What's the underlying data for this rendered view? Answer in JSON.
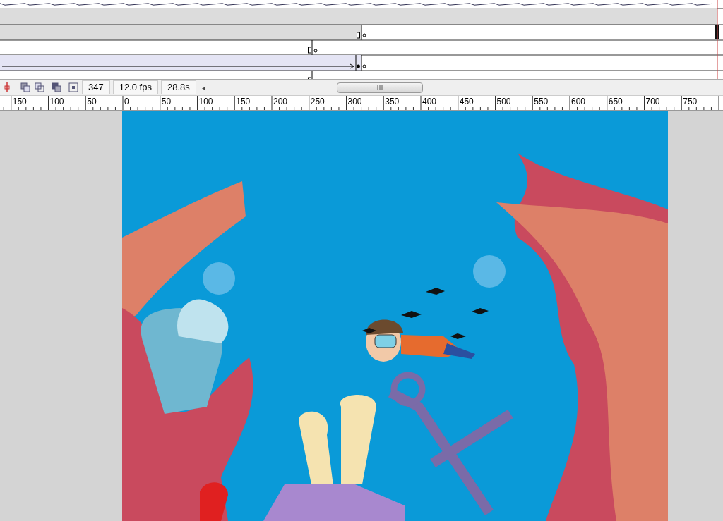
{
  "timeline": {
    "rows": [
      {
        "kind": "waveform"
      },
      {
        "kind": "static"
      },
      {
        "kind": "static-keyframe"
      },
      {
        "kind": "keyframe"
      },
      {
        "kind": "tween"
      },
      {
        "kind": "partial"
      }
    ],
    "status": {
      "frame": "347",
      "rate": "12.0 fps",
      "elapsed": "28.8s",
      "scroll_arrow": "◂"
    }
  },
  "ruler": {
    "labels": [
      "150",
      "100",
      "50",
      "0",
      "50",
      "100",
      "150",
      "200",
      "250",
      "300",
      "350",
      "400",
      "450",
      "500",
      "550",
      "600",
      "650",
      "700",
      "750"
    ]
  }
}
